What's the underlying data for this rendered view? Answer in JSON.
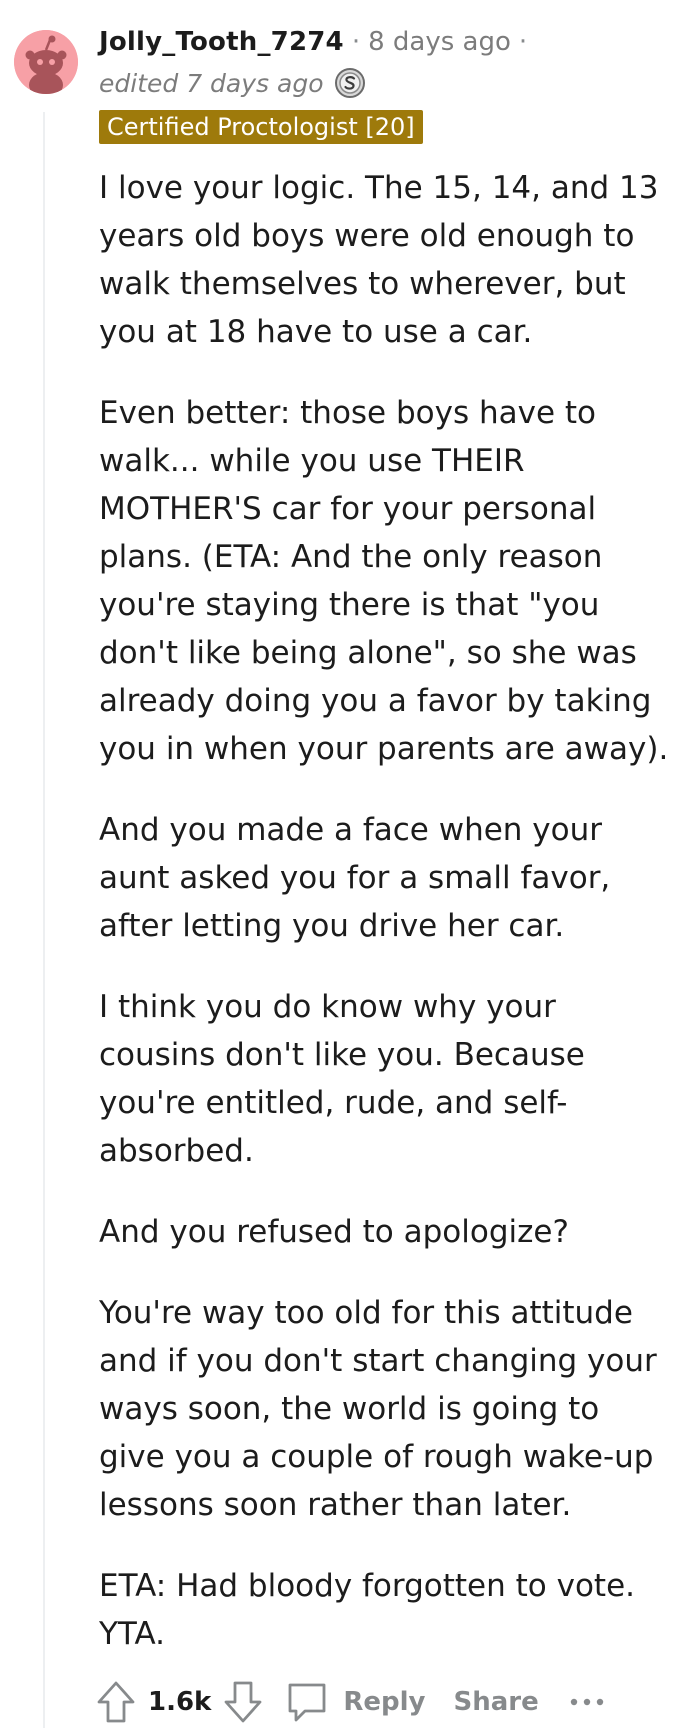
{
  "comment": {
    "username": "Jolly_Tooth_7274",
    "separator": "·",
    "timestamp": "8 days ago",
    "edited": "edited 7 days ago",
    "award_icon": "silver-award-icon",
    "avatar_icon": "reddit-snoo-avatar-icon",
    "flair": "Certified Proctologist [20]",
    "flair_color": "#9e7a0b",
    "avatar_color": "#f7a0a6",
    "paragraphs": [
      "I love your logic. The 15, 14, and 13\nyears old boys were old enough to\nwalk themselves to wherever, but\nyou at 18 have to use a car.",
      "Even better: those boys have to\nwalk... while you use THEIR\nMOTHER'S car for your personal\nplans. (ETA: And the only reason\nyou're staying there is that \"you\ndon't like being alone\", so she was\nalready doing you a favor by taking\nyou in when your parents are away).",
      "And you made a face when your\naunt asked you for a small favor,\nafter letting you drive her car.",
      "I think you do know why your\ncousins don't like you. Because\nyou're entitled, rude, and self-\nabsorbed.",
      "And you refused to apologize?",
      "You're way too old for this attitude\nand if you don't start changing your\nways soon, the world is going to\ngive you a couple of rough wake-up\nlessons soon rather than later.",
      "ETA: Had bloody forgotten to vote.\nYTA."
    ]
  },
  "actions": {
    "score": "1.6k",
    "reply_label": "Reply",
    "share_label": "Share",
    "upvote_icon": "upvote-arrow-icon",
    "downvote_icon": "downvote-arrow-icon",
    "reply_icon": "comment-bubble-icon",
    "more_icon": "more-options-icon"
  }
}
